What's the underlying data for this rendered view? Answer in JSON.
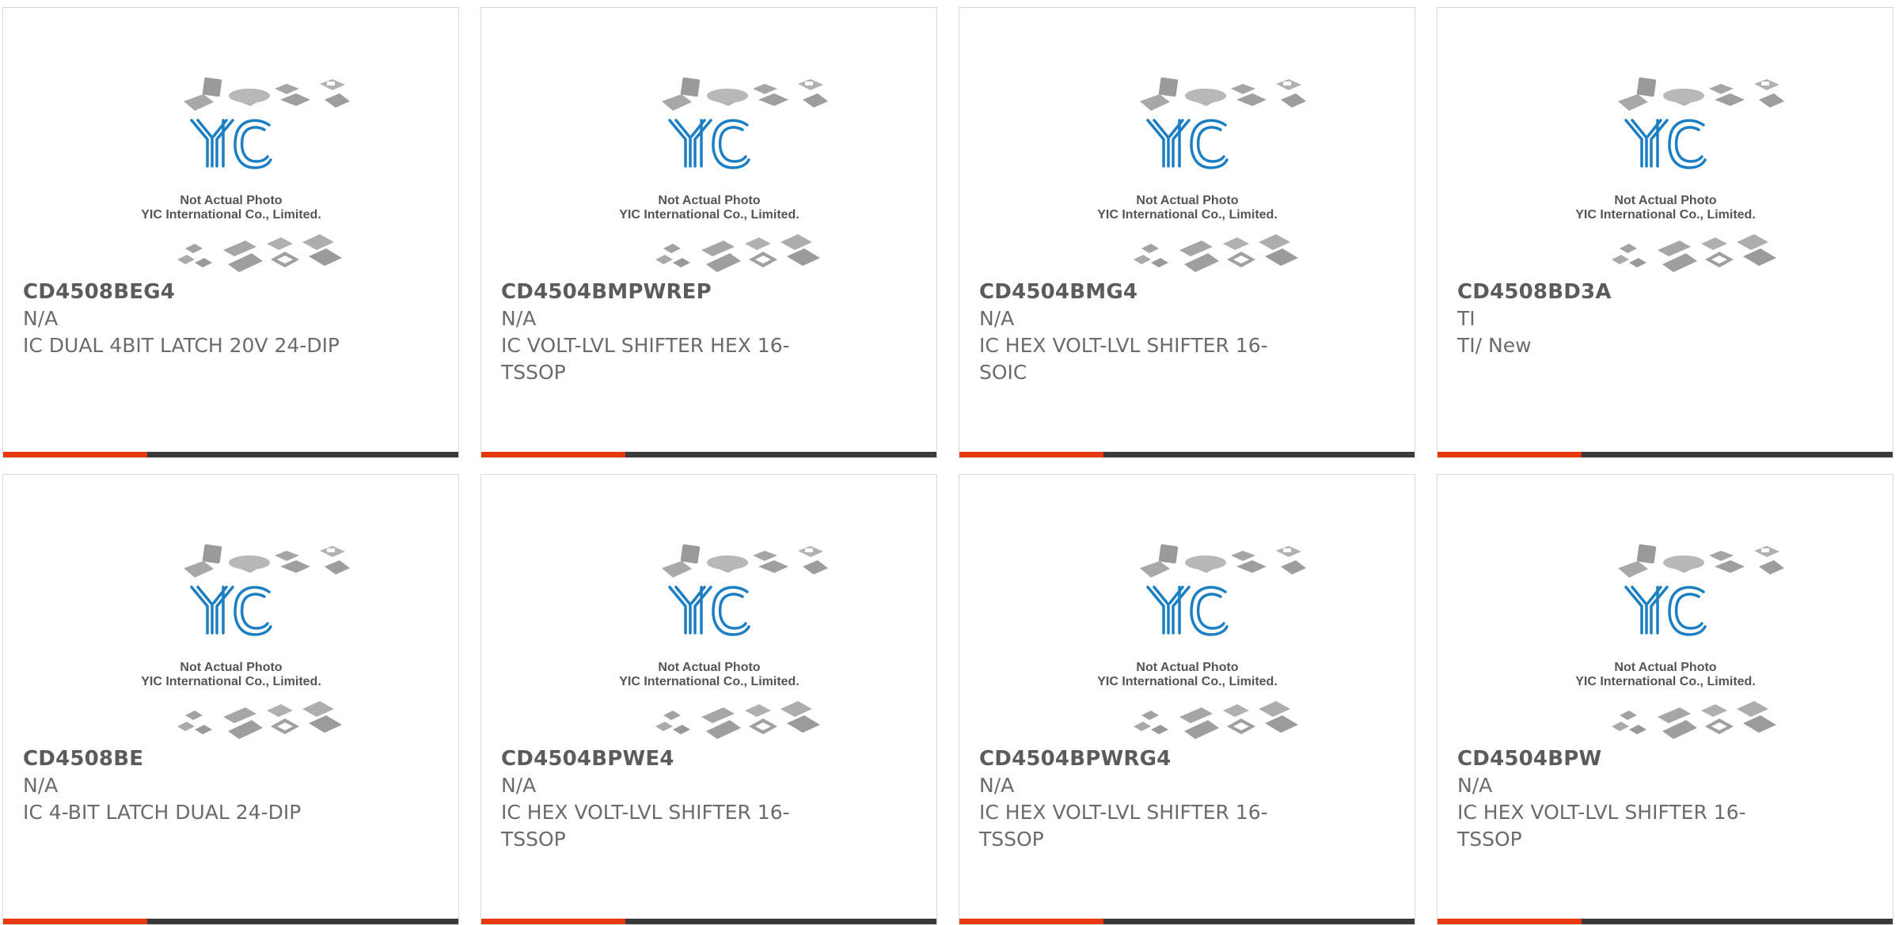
{
  "brand": {
    "logo_text": "YIC",
    "photo_note": "Not Actual Photo",
    "company": "YIC International Co., Limited.",
    "logo_color": "#1c7fc4"
  },
  "colors": {
    "accent": "#e8380d",
    "bar": "#3a3a3a",
    "text": "#666666",
    "border": "#d9d9d9"
  },
  "products": [
    {
      "part": "CD4508BEG4",
      "manufacturer": "N/A",
      "description": "IC DUAL 4BIT LATCH 20V 24-DIP"
    },
    {
      "part": "CD4504BMPWREP",
      "manufacturer": "N/A",
      "description": "IC VOLT-LVL SHIFTER HEX 16-TSSOP"
    },
    {
      "part": "CD4504BMG4",
      "manufacturer": "N/A",
      "description": "IC HEX VOLT-LVL SHIFTER 16-SOIC"
    },
    {
      "part": "CD4508BD3A",
      "manufacturer": "TI",
      "description": "TI/ New"
    },
    {
      "part": "CD4508BE",
      "manufacturer": "N/A",
      "description": "IC 4-BIT LATCH DUAL 24-DIP"
    },
    {
      "part": "CD4504BPWE4",
      "manufacturer": "N/A",
      "description": "IC HEX VOLT-LVL SHIFTER 16-TSSOP"
    },
    {
      "part": "CD4504BPWRG4",
      "manufacturer": "N/A",
      "description": "IC HEX VOLT-LVL SHIFTER 16-TSSOP"
    },
    {
      "part": "CD4504BPW",
      "manufacturer": "N/A",
      "description": "IC HEX VOLT-LVL SHIFTER 16-TSSOP"
    }
  ]
}
